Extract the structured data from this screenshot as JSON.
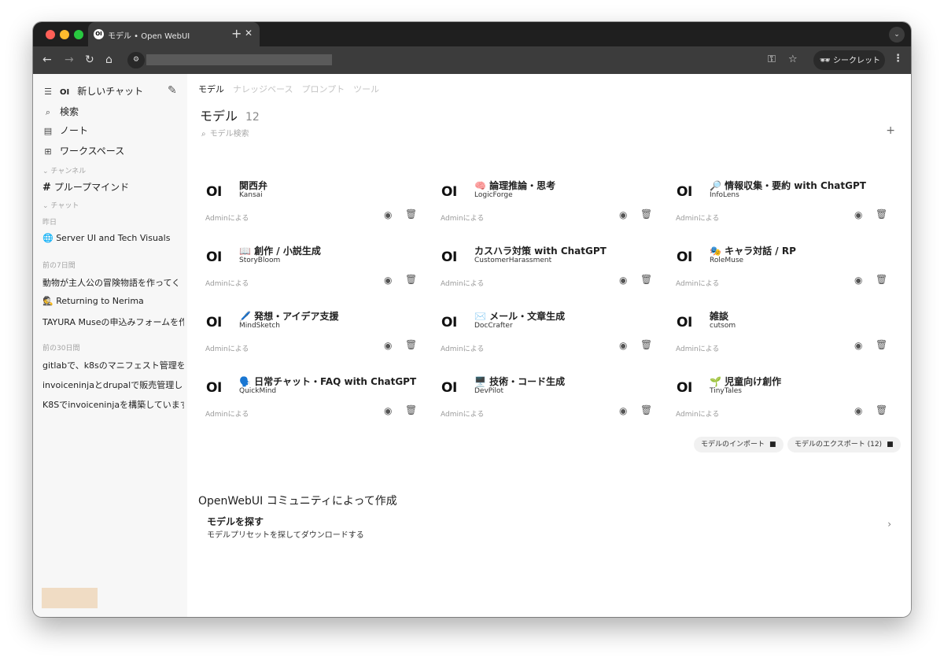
{
  "browser": {
    "tab_title": "モデル • Open WebUI",
    "favicon": "OI",
    "incognito_label": "シークレット"
  },
  "sidebar": {
    "new_chat": "新しいチャット",
    "search": "検索",
    "notes": "ノート",
    "workspace": "ワークスペース",
    "channels_label": "チャンネル",
    "channel_name": "プループマインド",
    "chats_label": "チャット",
    "groups": [
      {
        "label": "昨日",
        "chats": [
          "🌐 Server UI and Tech Visuals"
        ]
      },
      {
        "label": "前の7日間",
        "chats": [
          "動物が主人公の冒険物語を作ってく",
          "🕵️ Returning to Nerima",
          "TAYURA Museの申込みフォームを作"
        ]
      },
      {
        "label": "前の30日間",
        "chats": [
          "gitlabで、k8sのマニフェスト管理を",
          "invoiceninjaとdrupalで販売管理しま",
          "K8Sでinvoiceninjaを構築しています"
        ]
      }
    ]
  },
  "main": {
    "tabs": [
      "モデル",
      "ナレッジベース",
      "プロンプト",
      "ツール"
    ],
    "title": "モデル",
    "count": "12",
    "search_placeholder": "モデル検索",
    "models": [
      {
        "name": "関西弁",
        "id": "Kansai",
        "author": "Adminによる"
      },
      {
        "name": "🧠 論理推論・思考",
        "id": "LogicForge",
        "author": "Adminによる"
      },
      {
        "name": "🔎 情報収集・要約 with ChatGPT",
        "id": "InfoLens",
        "author": "Adminによる"
      },
      {
        "name": "📖 創作 / 小説生成",
        "id": "StoryBloom",
        "author": "Adminによる"
      },
      {
        "name": "カスハラ対策 with ChatGPT",
        "id": "CustomerHarassment",
        "author": "Adminによる"
      },
      {
        "name": "🎭 キャラ対話 / RP",
        "id": "RoleMuse",
        "author": "Adminによる"
      },
      {
        "name": "🖊️ 発想・アイデア支援",
        "id": "MindSketch",
        "author": "Adminによる"
      },
      {
        "name": "✉️ メール・文章生成",
        "id": "DocCrafter",
        "author": "Adminによる"
      },
      {
        "name": "雑談",
        "id": "cutsom",
        "author": "Adminによる"
      },
      {
        "name": "🗣️ 日常チャット・FAQ with ChatGPT",
        "id": "QuickMind",
        "author": "Adminによる"
      },
      {
        "name": "🖥️ 技術・コード生成",
        "id": "DevPilot",
        "author": "Adminによる"
      },
      {
        "name": "🌱 児童向け創作",
        "id": "TinyTales",
        "author": "Adminによる"
      }
    ],
    "import_label": "モデルのインポート",
    "export_label": "モデルのエクスポート (12)",
    "community_title": "OpenWebUI コミュニティによって作成",
    "explore_title": "モデルを探す",
    "explore_desc": "モデルプリセットを探してダウンロードする"
  }
}
